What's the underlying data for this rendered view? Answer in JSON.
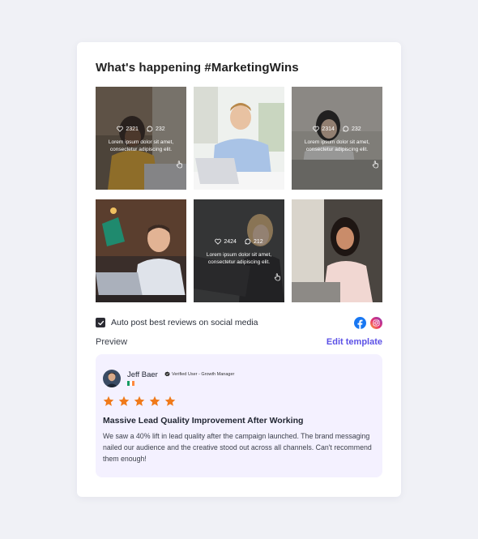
{
  "header": {
    "title": "What's happening #MarketingWins"
  },
  "tiles": [
    {
      "likes": "2321",
      "comments": "232",
      "caption": "Lorem ipsum dolor sit amet, consectetur adipiscing elit."
    },
    {
      "likes": "",
      "comments": "",
      "caption": ""
    },
    {
      "likes": "2314",
      "comments": "232",
      "caption": "Lorem ipsum dolor sit amet, consectetur adipiscing elit."
    },
    {
      "likes": "",
      "comments": "",
      "caption": ""
    },
    {
      "likes": "2424",
      "comments": "212",
      "caption": "Lorem ipsum dolor sit amet, consectetur adipiscing elit."
    },
    {
      "likes": "",
      "comments": "",
      "caption": ""
    }
  ],
  "auto_post": {
    "label": "Auto post best reviews on social media",
    "checked": true
  },
  "preview": {
    "label": "Preview",
    "edit_label": "Edit template"
  },
  "review": {
    "name": "Jeff Baer",
    "badge": "Verified User - Growth Manager",
    "rating": 5,
    "headline": "Massive Lead Quality Improvement After Working",
    "body": "We saw a 40% lift in lead quality after the campaign launched. The brand messaging nailed our audience  and the creative stood out across all channels. Can't recommend them enough!"
  },
  "colors": {
    "accent": "#5b50e6",
    "star": "#f07a1a",
    "review_bg": "#f4f1ff",
    "facebook": "#1877f2"
  },
  "icons": [
    "heart-icon",
    "comment-icon",
    "pointer-hand-icon",
    "check-icon",
    "facebook-icon",
    "instagram-icon",
    "verified-icon",
    "star-icon"
  ]
}
